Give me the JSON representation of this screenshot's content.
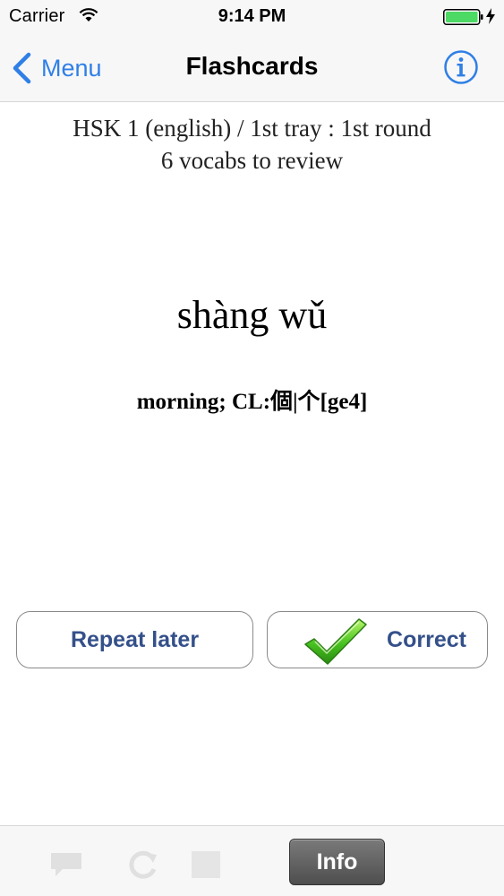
{
  "status_bar": {
    "carrier": "Carrier",
    "time": "9:14 PM",
    "wifi_icon": "wifi-icon",
    "battery_icon": "battery-icon",
    "battery_color": "#4cd964"
  },
  "nav": {
    "back_label": "Menu",
    "title": "Flashcards",
    "info_icon": "info-circle-icon",
    "accent_color": "#2f7fe6"
  },
  "card": {
    "deck_line": "HSK 1 (english) / 1st tray : 1st round",
    "count_line": "6 vocabs to review",
    "pinyin": "shàng wǔ",
    "meaning": "morning; CL:個|个[ge4]"
  },
  "actions": {
    "repeat_label": "Repeat later",
    "correct_label": "Correct",
    "correct_icon": "checkmark-icon",
    "label_color": "#34508a"
  },
  "toolbar": {
    "icons": [
      "comment-icon",
      "refresh-icon",
      "card-icon"
    ],
    "info_label": "Info"
  }
}
